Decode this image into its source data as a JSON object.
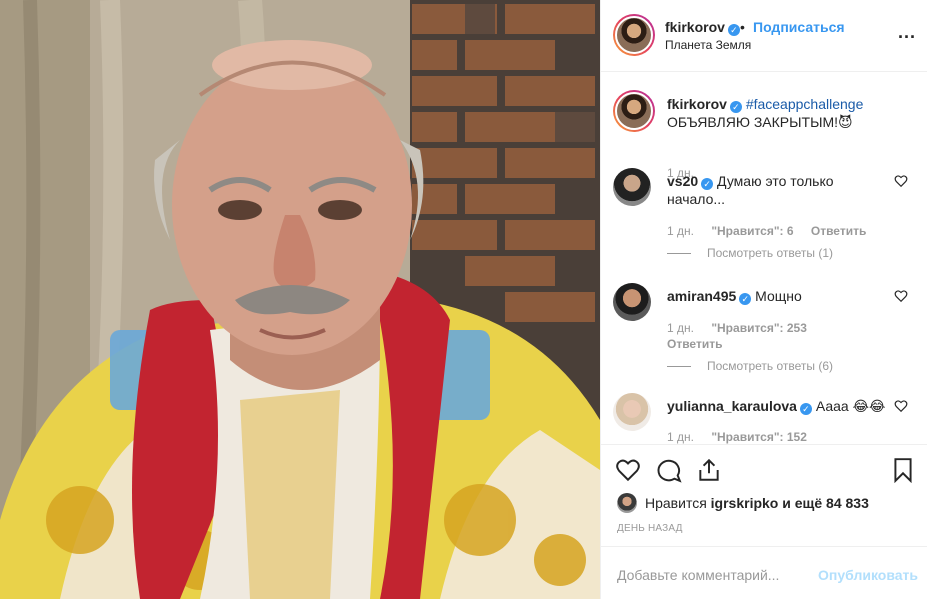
{
  "post": {
    "username": "fkirkorov",
    "follow_label": "Подписаться",
    "dot": "•",
    "location": "Планета Земля",
    "more_label": "...",
    "caption_hashtag": "#faceappchallenge",
    "caption_text": "ОБЪЯВЛЯЮ ЗАКРЫТЫМ!😈",
    "caption_time": "1 дн."
  },
  "comments": [
    {
      "username": "vs20",
      "text": "Думаю это только начало...",
      "time": "1 дн.",
      "likes": "\"Нравится\": 6",
      "reply": "Ответить",
      "replies": "Посмотреть ответы (1)"
    },
    {
      "username": "amiran495",
      "text": "Мощно",
      "time": "1 дн.",
      "likes": "\"Нравится\": 253",
      "reply": "Ответить",
      "replies": "Посмотреть ответы (6)"
    },
    {
      "username": "yulianna_karaulova",
      "text": "Аааа 😂😂",
      "time": "1 дн.",
      "likes": "\"Нравится\": 152"
    }
  ],
  "likes": {
    "prefix": "Нравится",
    "user": "igrskripko",
    "suffix": "и ещё 84 833"
  },
  "date": "ДЕНЬ НАЗАД",
  "add_comment": {
    "placeholder": "Добавьте комментарий...",
    "publish_label": "Опубликовать"
  },
  "colors": {
    "link_blue": "#3897f0",
    "publish_disabled": "#b2dffc",
    "muted": "#999999"
  }
}
